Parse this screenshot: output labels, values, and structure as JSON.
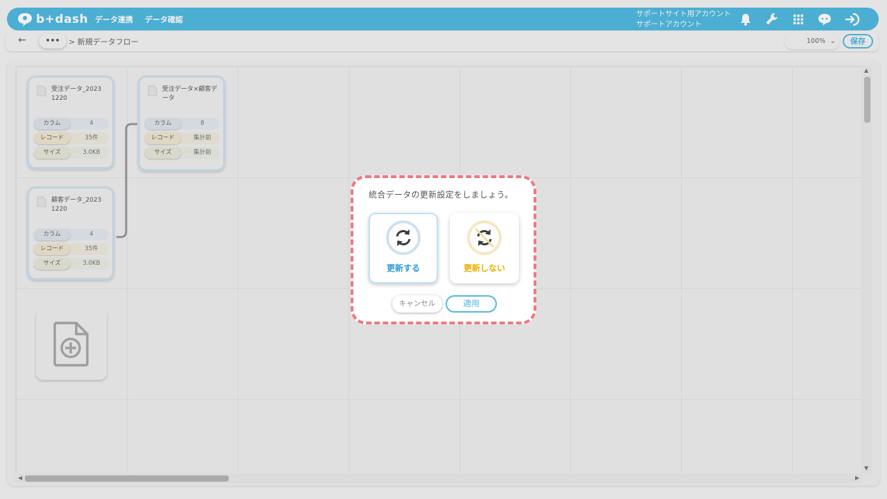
{
  "app": {
    "name": "b+dash"
  },
  "header": {
    "nav": [
      "データ連携",
      "データ確認"
    ],
    "account": {
      "line1": "サポートサイト用アカウント",
      "line2": "サポートアカウント"
    },
    "icons": [
      "bell-icon",
      "wrench-icon",
      "apps-grid-icon",
      "support-chat-icon",
      "logout-icon"
    ]
  },
  "toolbar": {
    "back": "←",
    "more": "•••",
    "breadcrumb": "> 新規データフロー",
    "zoom": "100%",
    "save_label": "保存"
  },
  "nodes": [
    {
      "title": "受注データ_2023 1220",
      "column_label": "カラム",
      "column_value": "4",
      "record_label": "レコード",
      "record_value": "35件",
      "size_label": "サイズ",
      "size_value": "3.0KB"
    },
    {
      "title": "顧客データ_2023 1220",
      "column_label": "カラム",
      "column_value": "4",
      "record_label": "レコード",
      "record_value": "35件",
      "size_label": "サイズ",
      "size_value": "3.0KB"
    },
    {
      "title": "受注データ×顧客データ",
      "column_label": "カラム",
      "column_value": "8",
      "record_label": "レコード",
      "record_value": "集計前",
      "size_label": "サイズ",
      "size_value": "集計前"
    }
  ],
  "dialog": {
    "title": "統合データの更新設定をしましょう。",
    "option_update": "更新する",
    "option_no_update": "更新しない",
    "selected": "更新する",
    "cancel": "キャンセル",
    "apply": "適用"
  },
  "colors": {
    "brand": "#51b9e0",
    "dialog_border": "#f0787f",
    "update_accent": "#2b9ad6",
    "no_update_accent": "#e9b100"
  }
}
